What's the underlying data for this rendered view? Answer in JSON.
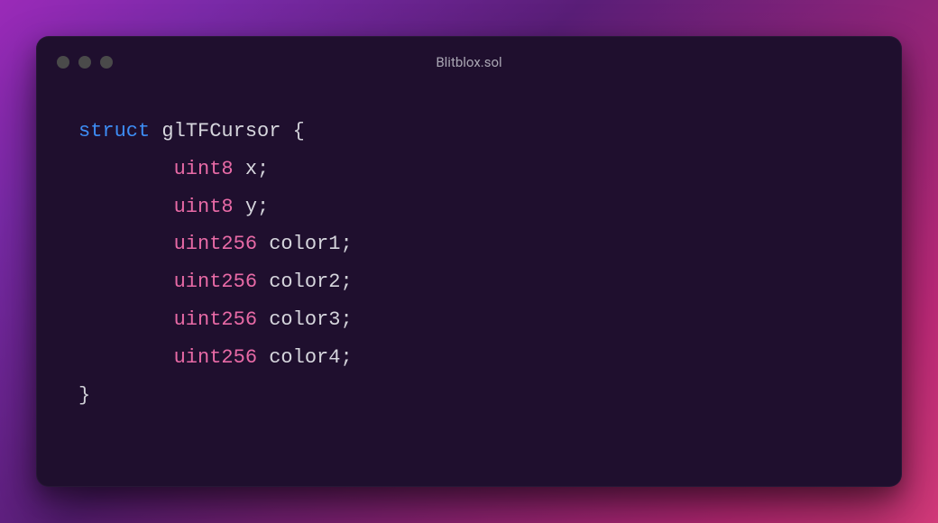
{
  "window": {
    "title": "Blitblox.sol"
  },
  "colors": {
    "keyword": "#3d8df5",
    "type": "#e86aa6",
    "identifier": "#d6d6dd",
    "punct": "#cfcfd6",
    "background": "#1f0f2e"
  },
  "code": {
    "keyword_struct": "struct",
    "struct_name": "glTFCursor",
    "brace_open": "{",
    "brace_close": "}",
    "semicolon": ";",
    "fields": [
      {
        "type": "uint8",
        "name": "x"
      },
      {
        "type": "uint8",
        "name": "y"
      },
      {
        "type": "uint256",
        "name": "color1"
      },
      {
        "type": "uint256",
        "name": "color2"
      },
      {
        "type": "uint256",
        "name": "color3"
      },
      {
        "type": "uint256",
        "name": "color4"
      }
    ]
  }
}
